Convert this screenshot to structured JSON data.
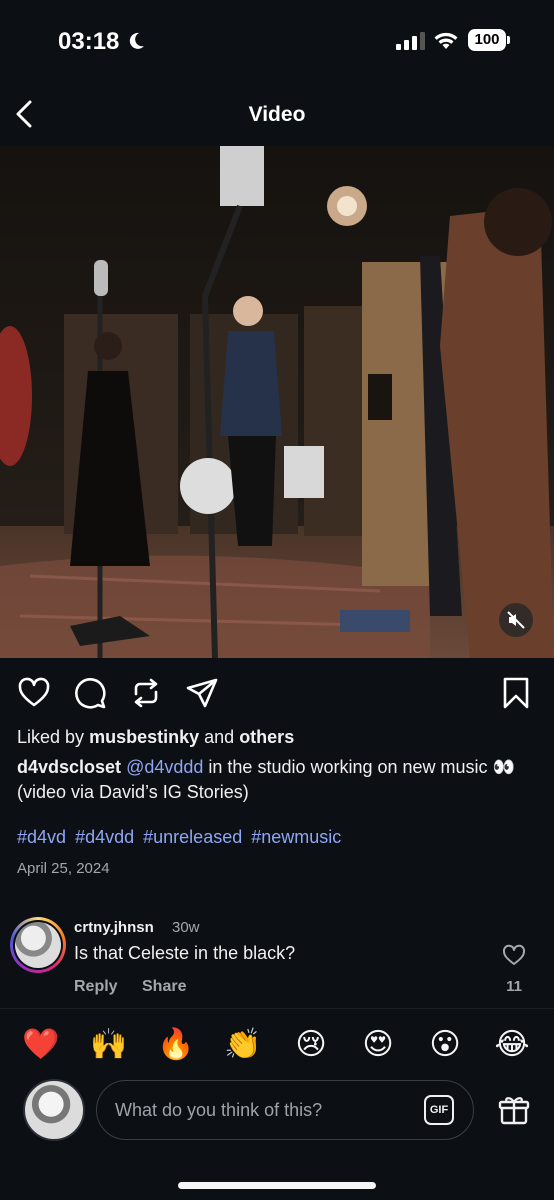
{
  "status_bar": {
    "time": "03:18",
    "battery": "100"
  },
  "nav": {
    "title": "Video"
  },
  "post": {
    "liked_by_prefix": "Liked by",
    "liked_by_user": "musbestinky",
    "liked_by_and": "and",
    "liked_by_others": "others",
    "author": "d4vdscloset",
    "mention": "@d4vddd",
    "caption_text": "in the studio working on new music 👀 (video via David’s IG Stories)",
    "hashtags": [
      "#d4vd",
      "#d4vdd",
      "#unreleased",
      "#newmusic"
    ],
    "date": "April 25, 2024"
  },
  "comment": {
    "username": "crtny.jhnsn",
    "time": "30w",
    "text": "Is that Celeste in the black?",
    "reply_label": "Reply",
    "share_label": "Share",
    "like_count": "11"
  },
  "reactions": [
    "❤️",
    "🙌",
    "🔥",
    "👏",
    "😢",
    "😍",
    "😮",
    "😂"
  ],
  "composer": {
    "placeholder": "What do you think of this?",
    "gif_label": "GIF"
  },
  "colors": {
    "background": "#0c0f14",
    "link": "#8fa6f5",
    "muted": "#a4a8ae"
  }
}
